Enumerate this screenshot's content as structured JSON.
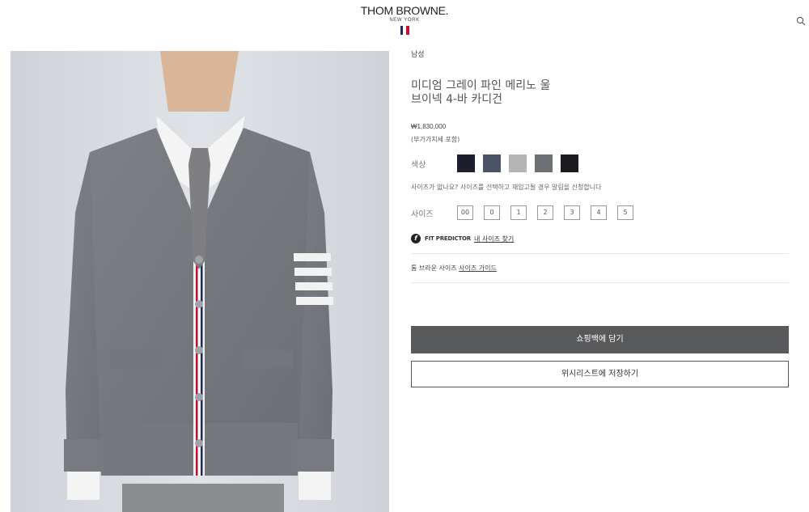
{
  "header": {
    "brand": "THOM BROWNE.",
    "city": "NEW YORK",
    "flag_colors": [
      "#1f2a5a",
      "#ffffff",
      "#c8102e"
    ]
  },
  "product": {
    "category": "남성",
    "title_line1": "미디엄 그레이 파인 메리노 울",
    "title_line2": "브이넥 4-바 카디건",
    "price": "₩1,830,000",
    "vat_note": "(부가가치세 포함)",
    "color_label": "색상",
    "colors": [
      "#1c1f2b",
      "#4a5466",
      "#b7b4b5",
      "#6d7176",
      "#1a1b1f"
    ],
    "size_note": "사이즈가 없나요? 사이즈를 선택하고 재입고될 경우 알림을 신청합니다",
    "size_label": "사이즈",
    "sizes": [
      "00",
      "0",
      "1",
      "2",
      "3",
      "4",
      "5"
    ],
    "fit_predictor": "FIT PREDICTOR",
    "fit_link": "내 사이즈 찾기",
    "guide_prefix": "톰 브라운 사이즈",
    "guide_link": "사이즈 가이드",
    "add_to_bag": "쇼핑백에 담기",
    "wishlist": "위시리스트에 저장하기"
  }
}
